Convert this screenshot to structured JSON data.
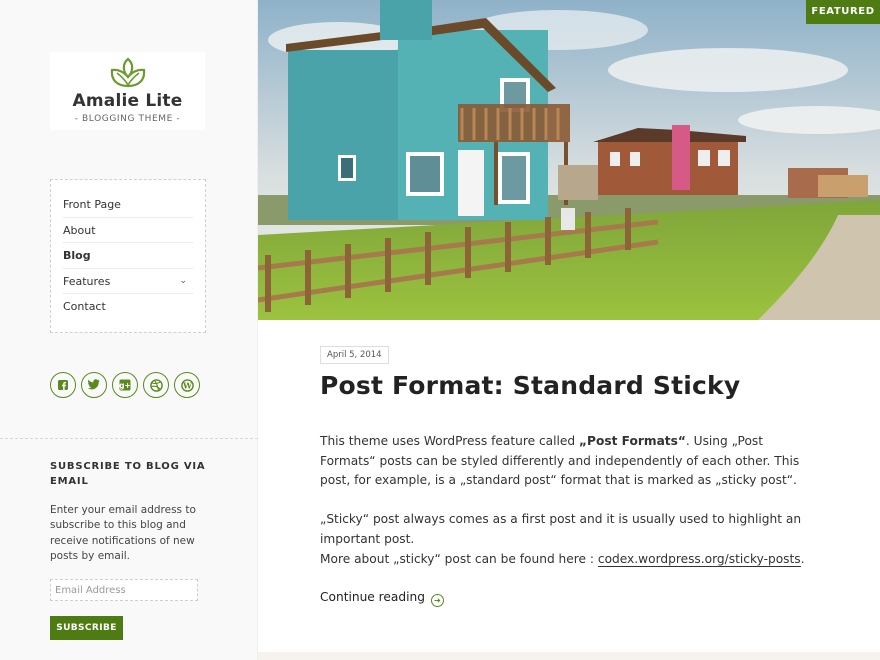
{
  "site": {
    "title": "Amalie Lite",
    "tagline": "- BLOGGING THEME -"
  },
  "menu": {
    "items": [
      {
        "label": "Front Page",
        "active": false
      },
      {
        "label": "About",
        "active": false
      },
      {
        "label": "Blog",
        "active": true
      },
      {
        "label": "Features",
        "active": false,
        "has_submenu": true
      },
      {
        "label": "Contact",
        "active": false
      }
    ]
  },
  "social": {
    "icons": [
      "facebook-icon",
      "twitter-icon",
      "google-plus-icon",
      "dribbble-icon",
      "wordpress-icon"
    ]
  },
  "subscribe": {
    "title": "SUBSCRIBE TO BLOG VIA EMAIL",
    "description": "Enter your email address to subscribe to this blog and receive notifications of new posts by email.",
    "email_placeholder": "Email Address",
    "button_label": "SUBSCRIBE"
  },
  "post": {
    "badge": "FEATURED",
    "date": "April 5, 2014",
    "title": "Post Format: Standard Sticky",
    "p1_a": "This theme uses WordPress feature called ",
    "p1_bold": "„Post Formats“",
    "p1_b": ". Using „Post Formats“ posts can be styled differently and independently of each other. This post, for example, is a „standard post“ format that is marked as „sticky post“.",
    "p2": "„Sticky“ post always comes as a first post and it is usually used to highlight an important post.",
    "p3_a": "More about „sticky“ post can be found here : ",
    "p3_link": "codex.wordpress.org/sticky-posts",
    "p3_b": ".",
    "continue_label": "Continue reading"
  },
  "colors": {
    "accent": "#4f7c12",
    "sidebar_bg": "#f9f9f9",
    "text": "#333333"
  }
}
